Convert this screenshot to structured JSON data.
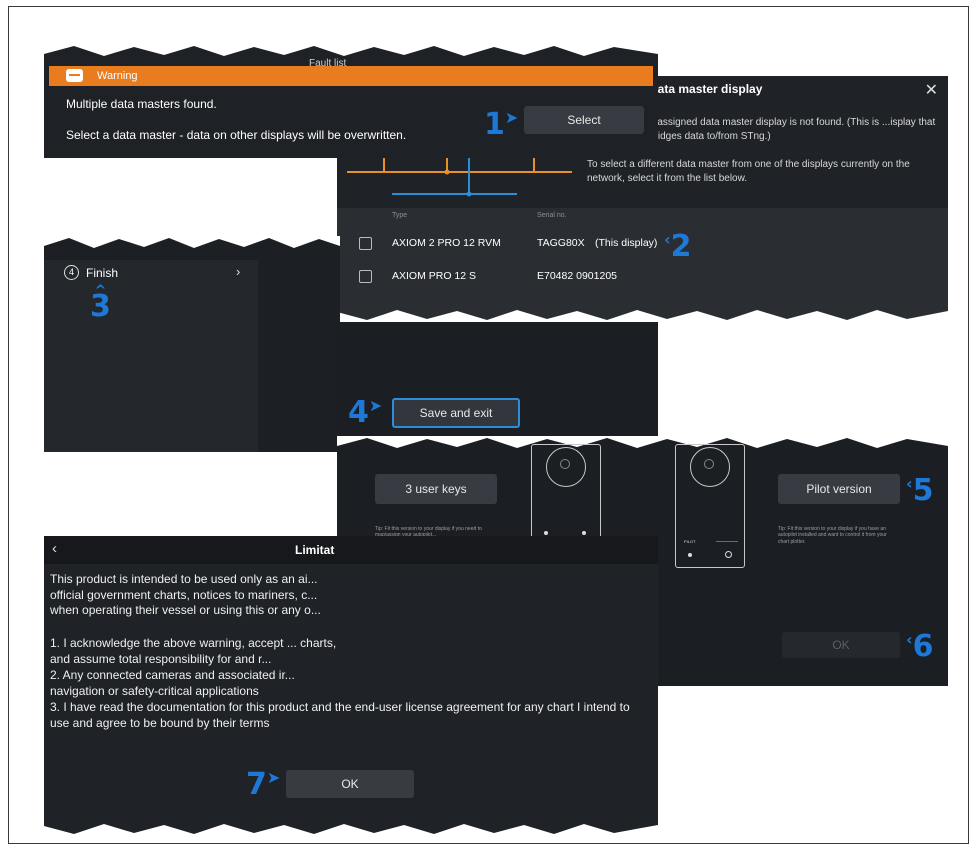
{
  "warning_panel": {
    "bg_title": "Fault list",
    "header": "Warning",
    "line1": "Multiple data masters found.",
    "line2": "Select a data master - data on other displays will be overwritten.",
    "select_button": "Select"
  },
  "data_master_panel": {
    "title": "Data master display",
    "close_icon": "close-icon",
    "desc1": "...assigned data master display is not found. (This is ...isplay that bridges data to/from STng.)",
    "desc2": "To select a different data master from one of the displays currently on the network, select it from the list below.",
    "col_type": "Type",
    "col_serial": "Serial no.",
    "rows": [
      {
        "type": "AXIOM 2 PRO 12 RVM",
        "serial": "TAGG80X",
        "note": "(This display)",
        "checked": false
      },
      {
        "type": "AXIOM PRO 12 S",
        "serial": "E70482 0901205",
        "note": "",
        "checked": false
      }
    ]
  },
  "finish_panel": {
    "step_number": "4",
    "label": "Finish",
    "chevron": "chevron-right-icon"
  },
  "save_panel": {
    "button": "Save and exit"
  },
  "keys_panel": {
    "left_button": "3 user keys",
    "right_button": "Pilot version",
    "left_tip": "Tip: Fit this version to your display if you need to map/assign your autopilot...",
    "right_tip": "Tip: Fit this version to your display if you have an autopilot installed and want to control it from your chart plotter.",
    "ok_button": "OK",
    "remote_label": "PILOT"
  },
  "limitations_panel": {
    "back_icon": "chevron-left-icon",
    "title": "Limitat",
    "para": "This product is intended to be used only as an ai... official government charts, notices to mariners, c... when operating their vessel or using this or any o...",
    "item1": "1. I acknowledge the above warning, accept ... charts, and assume total responsibility for and r...",
    "item2": "2. Any connected cameras and associated ir... navigation or safety-critical applications",
    "item3": "3. I have read the documentation for this product and the end-user license agreement for any chart I intend to use and agree to be bound by their terms",
    "ok_button": "OK"
  },
  "callouts": [
    "1",
    "2",
    "3",
    "4",
    "5",
    "6",
    "7"
  ],
  "colors": {
    "panel_bg": "#1f2226",
    "warning_orange": "#e87c1e",
    "callout_blue": "#1e78d8",
    "button_bg": "#383c42"
  }
}
